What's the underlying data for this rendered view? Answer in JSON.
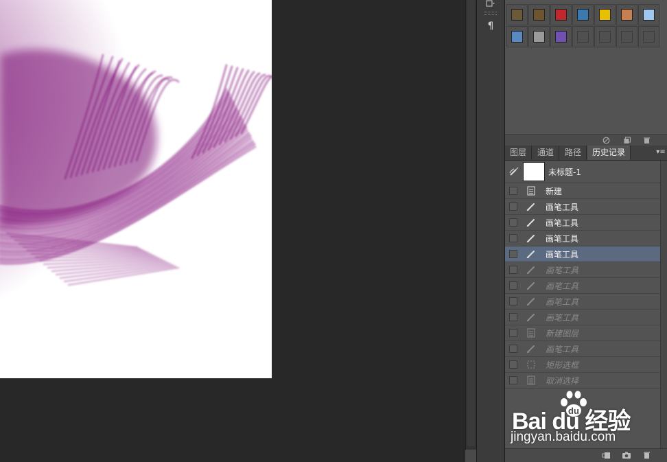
{
  "colors": {
    "paint": "#7a0a72",
    "workspace": "#282828",
    "panel": "#535353",
    "selected_row": "#5b6a80"
  },
  "dock": {
    "icons": [
      "tool-preset-icon",
      "paragraph-icon"
    ],
    "paragraph_glyph": "¶"
  },
  "styles_panel": {
    "swatches": [
      "#6b5a3a",
      "#6e5530",
      "#c0282e",
      "#3a7ab0",
      "#e8c000",
      "#c88050",
      "#9fc8f0",
      "#5a88c0",
      "#9a9a9a",
      "#7050b0",
      "",
      "",
      "",
      ""
    ],
    "footer_icons": [
      "no-style-icon",
      "new-style-icon",
      "trash-icon"
    ]
  },
  "tabs": [
    {
      "label": "图层"
    },
    {
      "label": "通道"
    },
    {
      "label": "路径"
    },
    {
      "label": "历史记录"
    }
  ],
  "snapshot": {
    "label": "未标题-1"
  },
  "history": [
    {
      "label": "新建",
      "icon": "document-icon",
      "state": "active"
    },
    {
      "label": "画笔工具",
      "icon": "brush-icon",
      "state": "active"
    },
    {
      "label": "画笔工具",
      "icon": "brush-icon",
      "state": "active"
    },
    {
      "label": "画笔工具",
      "icon": "brush-icon",
      "state": "active"
    },
    {
      "label": "画笔工具",
      "icon": "brush-icon",
      "state": "current"
    },
    {
      "label": "画笔工具",
      "icon": "brush-icon",
      "state": "dim"
    },
    {
      "label": "画笔工具",
      "icon": "brush-icon",
      "state": "dim"
    },
    {
      "label": "画笔工具",
      "icon": "brush-icon",
      "state": "dim"
    },
    {
      "label": "画笔工具",
      "icon": "brush-icon",
      "state": "dim"
    },
    {
      "label": "新建图层",
      "icon": "document-icon",
      "state": "dim"
    },
    {
      "label": "画笔工具",
      "icon": "brush-icon",
      "state": "dim"
    },
    {
      "label": "矩形选框",
      "icon": "marquee-icon",
      "state": "dim"
    },
    {
      "label": "取消选择",
      "icon": "document-icon",
      "state": "dim"
    }
  ],
  "history_footer_icons": [
    "new-document-from-state-icon",
    "camera-icon",
    "trash-icon"
  ],
  "watermark": {
    "brand": "Bai du 经验",
    "url": "jingyan.baidu.com"
  }
}
